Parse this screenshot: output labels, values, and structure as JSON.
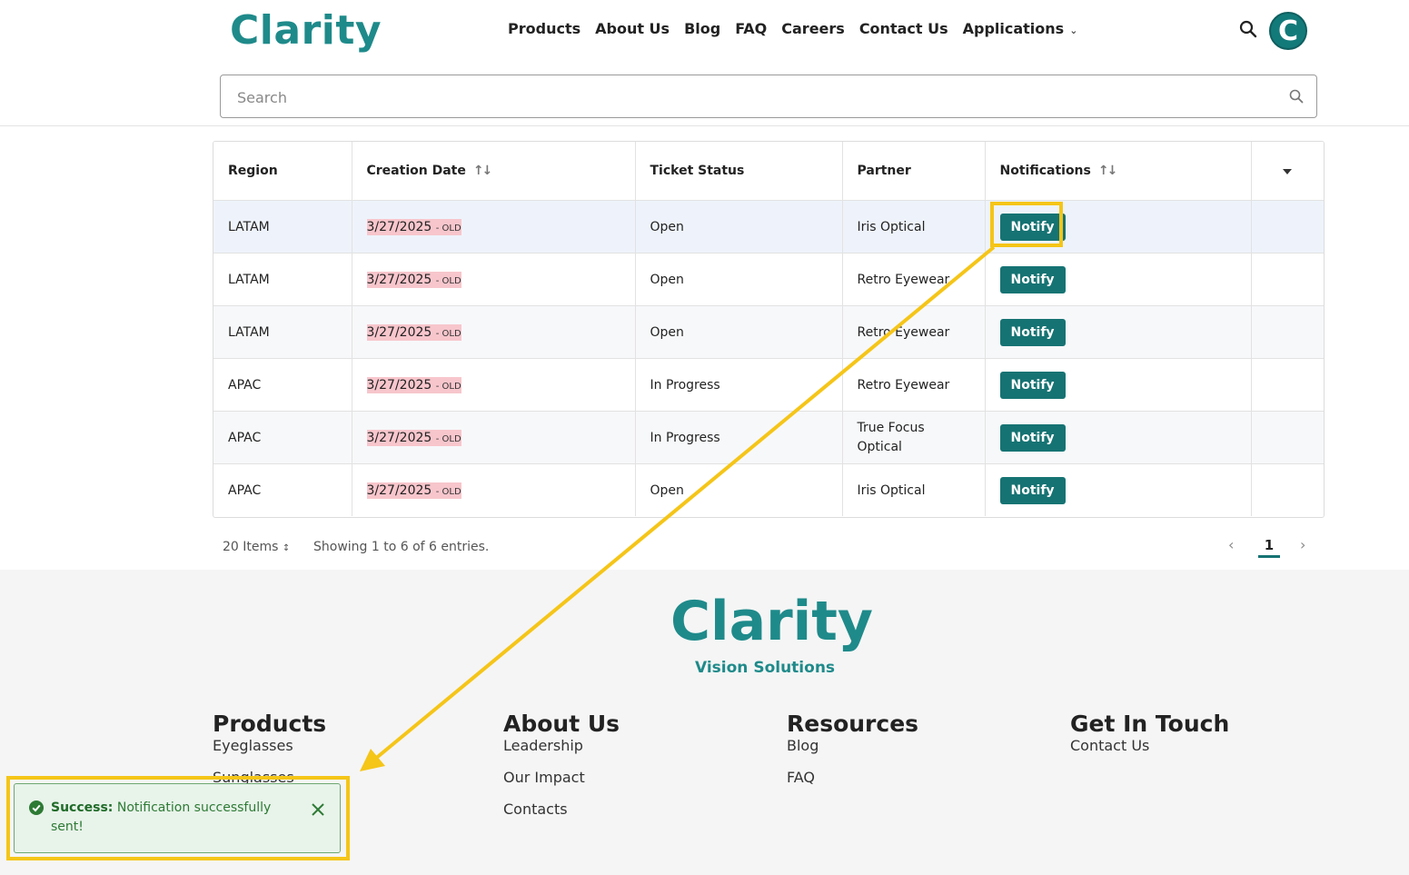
{
  "header": {
    "logo": "Clarity",
    "nav": [
      "Products",
      "About Us",
      "Blog",
      "FAQ",
      "Careers",
      "Contact Us",
      "Applications"
    ],
    "avatar_letter": "C"
  },
  "search": {
    "placeholder": "Search"
  },
  "table": {
    "columns": {
      "region": "Region",
      "creation_date": "Creation Date",
      "ticket_status": "Ticket Status",
      "partner": "Partner",
      "notifications": "Notifications"
    },
    "rows": [
      {
        "region": "LATAM",
        "date": "3/27/2025",
        "old": "- OLD",
        "status": "Open",
        "partner": "Iris Optical",
        "action": "Notify"
      },
      {
        "region": "LATAM",
        "date": "3/27/2025",
        "old": "- OLD",
        "status": "Open",
        "partner": "Retro Eyewear",
        "action": "Notify"
      },
      {
        "region": "LATAM",
        "date": "3/27/2025",
        "old": "- OLD",
        "status": "Open",
        "partner": "Retro Eyewear",
        "action": "Notify"
      },
      {
        "region": "APAC",
        "date": "3/27/2025",
        "old": "- OLD",
        "status": "In Progress",
        "partner": "Retro Eyewear",
        "action": "Notify"
      },
      {
        "region": "APAC",
        "date": "3/27/2025",
        "old": "- OLD",
        "status": "In Progress",
        "partner": "True Focus Optical",
        "action": "Notify"
      },
      {
        "region": "APAC",
        "date": "3/27/2025",
        "old": "- OLD",
        "status": "Open",
        "partner": "Iris Optical",
        "action": "Notify"
      }
    ]
  },
  "pagination": {
    "items_per_page": "20 Items",
    "showing": "Showing 1 to 6 of 6 entries.",
    "current_page": "1"
  },
  "footer": {
    "logo": "Clarity",
    "tagline": "Vision Solutions",
    "columns": [
      {
        "title": "Products",
        "links": [
          "Eyeglasses",
          "Sunglasses"
        ]
      },
      {
        "title": "About Us",
        "links": [
          "Leadership",
          "Our Impact",
          "Contacts"
        ]
      },
      {
        "title": "Resources",
        "links": [
          "Blog",
          "FAQ"
        ]
      },
      {
        "title": "Get In Touch",
        "links": [
          "Contact Us"
        ]
      }
    ]
  },
  "toast": {
    "label": "Success:",
    "message": "Notification successfully sent!"
  },
  "colors": {
    "brand": "#1f8a8a",
    "button": "#167373",
    "highlight": "#f5c518",
    "success_bg": "#e8f3ea",
    "old_date_bg": "#f7c6cc"
  }
}
